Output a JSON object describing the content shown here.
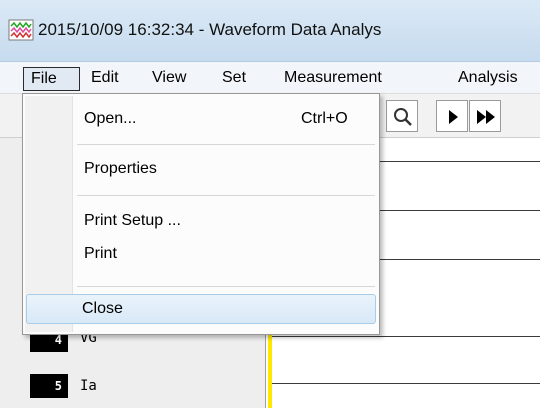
{
  "window": {
    "title": "2015/10/09 16:32:34  - Waveform Data Analys"
  },
  "menubar": {
    "items": [
      "File",
      "Edit",
      "View",
      "Set",
      "Measurement",
      "Analysis"
    ]
  },
  "file_menu": {
    "open_label": "Open...",
    "open_shortcut": "Ctrl+O",
    "properties_label": "Properties",
    "print_setup_label": "Print Setup ...",
    "print_label": "Print",
    "close_label": "Close"
  },
  "toolbar": {
    "icons": [
      "zoom-icon",
      "play-icon",
      "fast-forward-icon"
    ]
  },
  "channels": [
    {
      "number": "4",
      "name": "VG"
    },
    {
      "number": "5",
      "name": "Ia"
    }
  ],
  "colors": {
    "marker": "#ffe800",
    "channel_badge": "#000000",
    "menu_highlight": "#d8e9f7"
  }
}
